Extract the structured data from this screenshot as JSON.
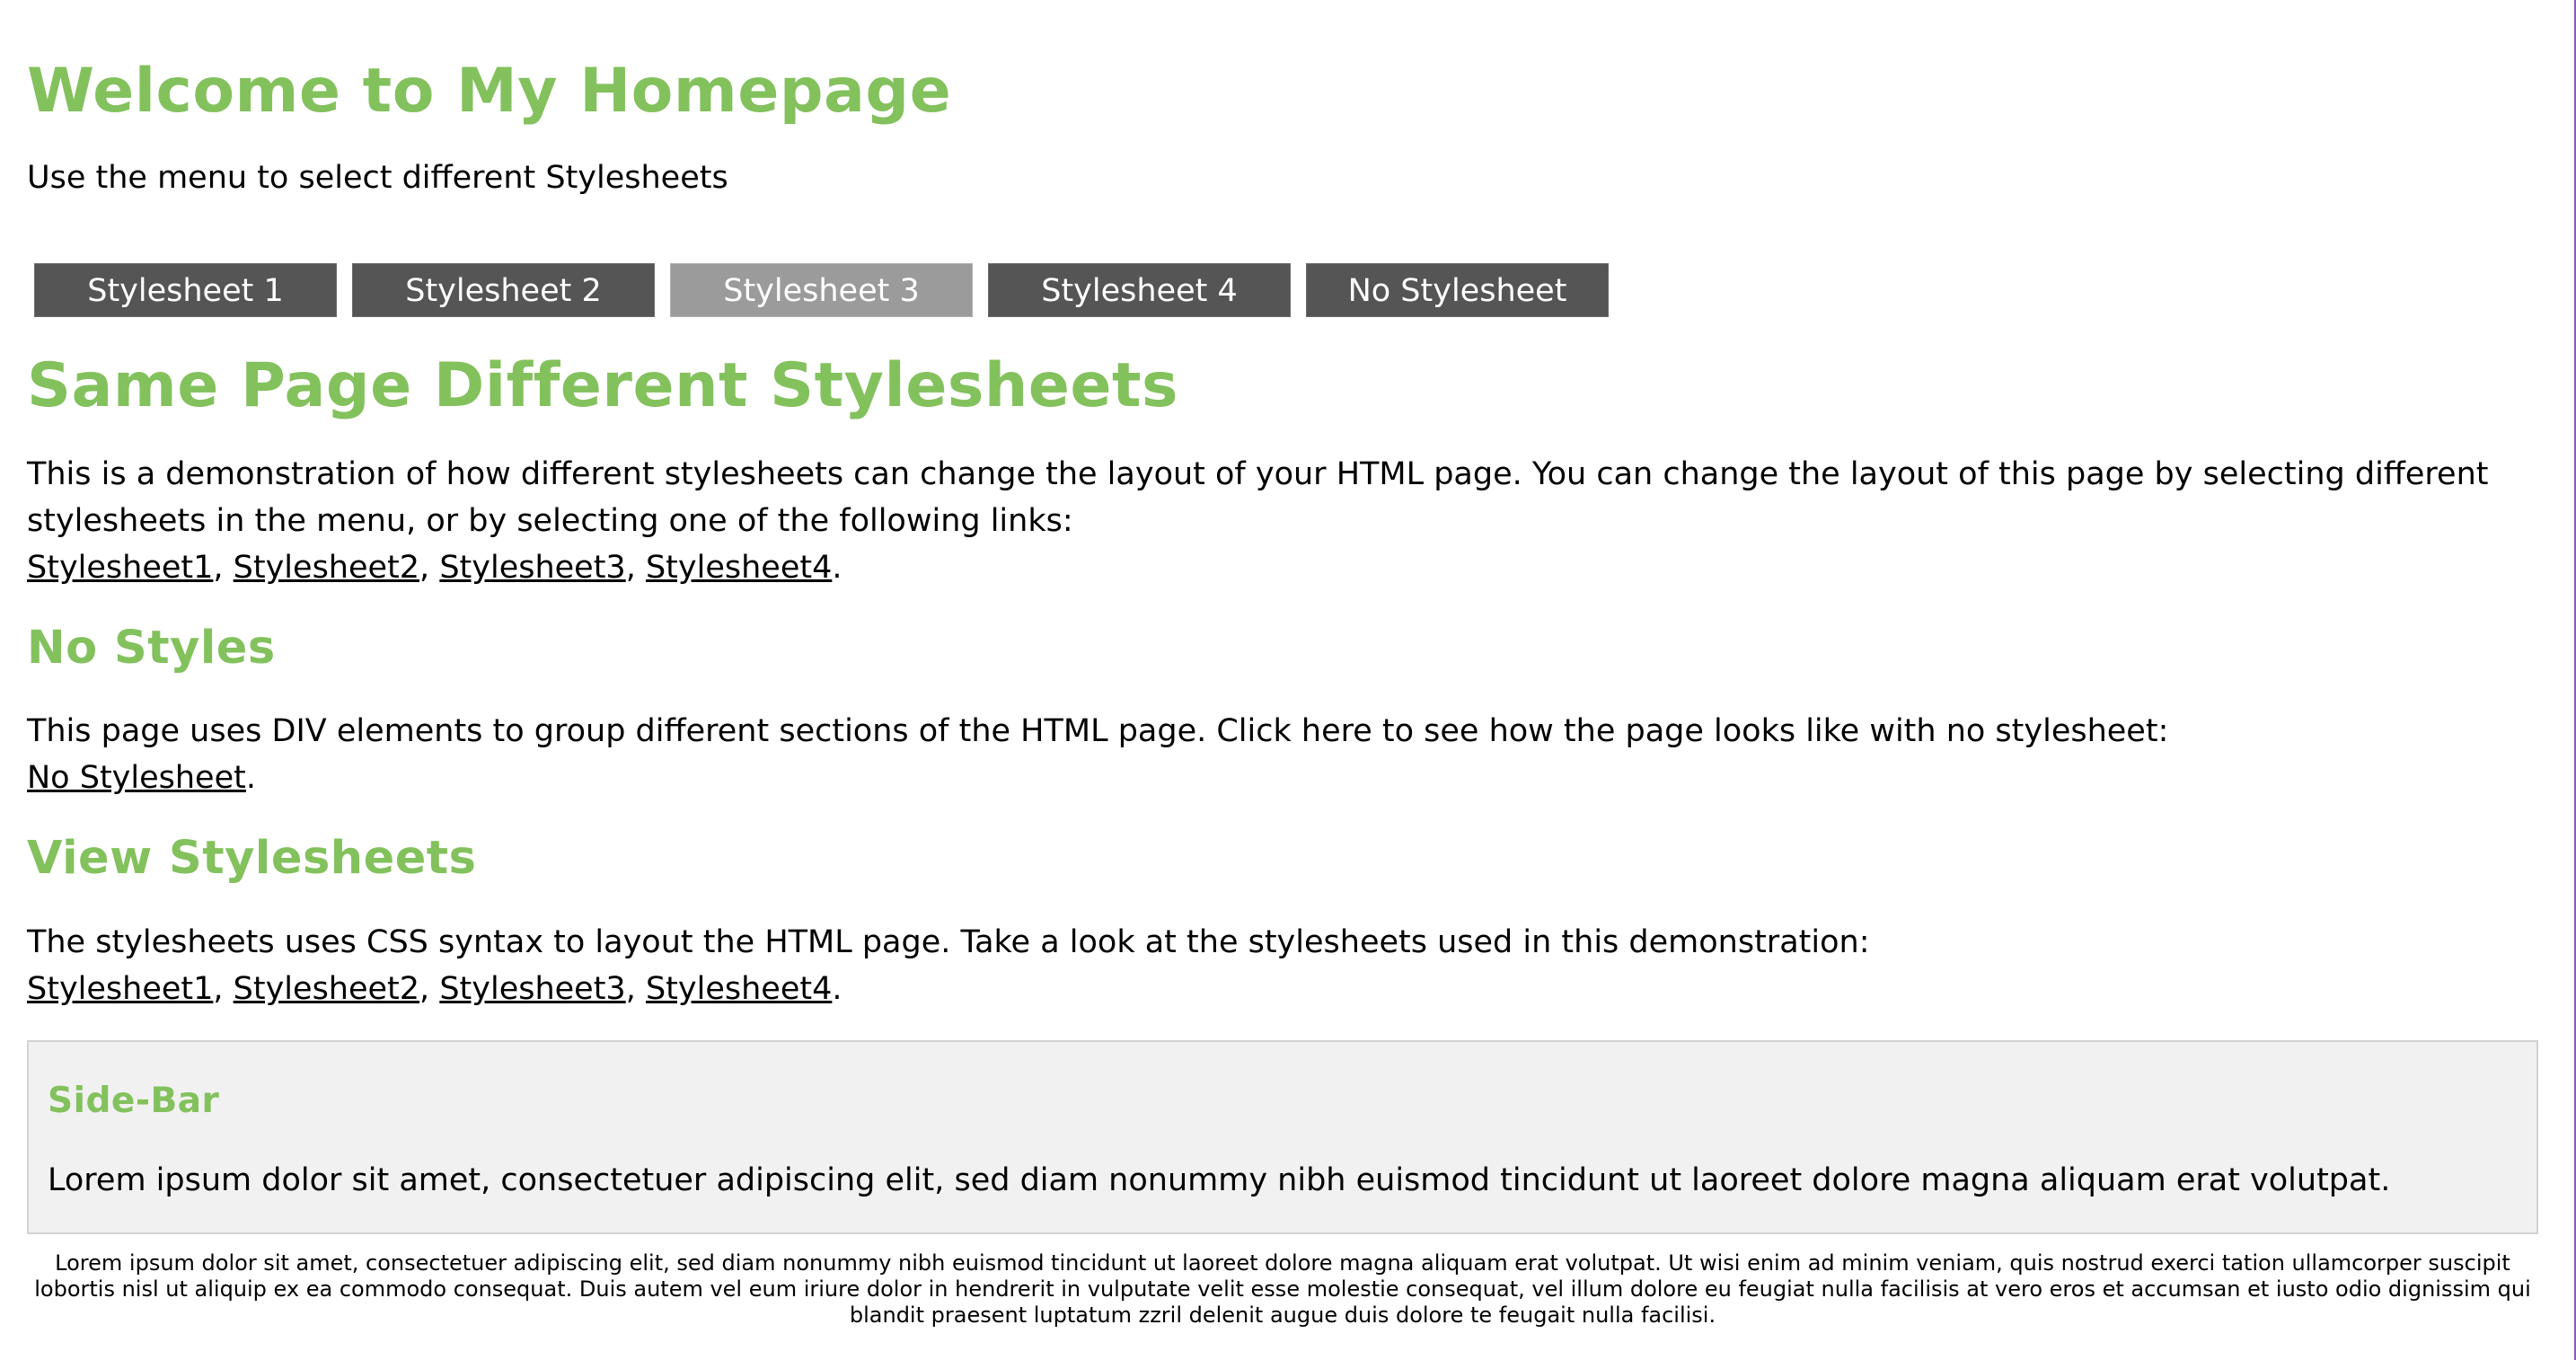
{
  "header": {
    "title": "Welcome to My Homepage",
    "subtitle": "Use the menu to select different Stylesheets"
  },
  "menu": {
    "items": [
      {
        "label": "Stylesheet 1",
        "active": false
      },
      {
        "label": "Stylesheet 2",
        "active": false
      },
      {
        "label": "Stylesheet 3",
        "active": true
      },
      {
        "label": "Stylesheet 4",
        "active": false
      },
      {
        "label": "No Stylesheet",
        "active": false
      }
    ]
  },
  "content": {
    "main_title": "Same Page Different Stylesheets",
    "intro_text": "This is a demonstration of how different stylesheets can change the layout of your HTML page. You can change the layout of this page by selecting different stylesheets in the menu, or by selecting one of the following links:",
    "links1": [
      "Stylesheet1",
      "Stylesheet2",
      "Stylesheet3",
      "Stylesheet4"
    ],
    "no_styles_title": "No Styles",
    "no_styles_text": "This page uses DIV elements to group different sections of the HTML page. Click here to see how the page looks like with no stylesheet:",
    "no_stylesheet_link": "No Stylesheet",
    "view_title": "View Stylesheets",
    "view_text": "The stylesheets uses CSS syntax to layout the HTML page. Take a look at the stylesheets used in this demonstration:",
    "links2": [
      "Stylesheet1",
      "Stylesheet2",
      "Stylesheet3",
      "Stylesheet4"
    ]
  },
  "sidebar": {
    "title": "Side-Bar",
    "text": "Lorem ipsum dolor sit amet, consectetuer adipiscing elit, sed diam nonummy nibh euismod tincidunt ut laoreet dolore magna aliquam erat volutpat."
  },
  "footer": {
    "text": "Lorem ipsum dolor sit amet, consectetuer adipiscing elit, sed diam nonummy nibh euismod tincidunt ut laoreet dolore magna aliquam erat volutpat. Ut wisi enim ad minim veniam, quis nostrud exerci tation ullamcorper suscipit lobortis nisl ut aliquip ex ea commodo consequat. Duis autem vel eum iriure dolor in hendrerit in vulputate velit esse molestie consequat, vel illum dolore eu feugiat nulla facilisis at vero eros et accumsan et iusto odio dignissim qui blandit praesent luptatum zzril delenit augue duis dolore te feugait nulla facilisi."
  },
  "colors": {
    "heading": "#83c15d",
    "menu_bg": "#555555",
    "menu_active_bg": "#9b9b9b",
    "sidebar_bg": "#f1f1f1"
  }
}
